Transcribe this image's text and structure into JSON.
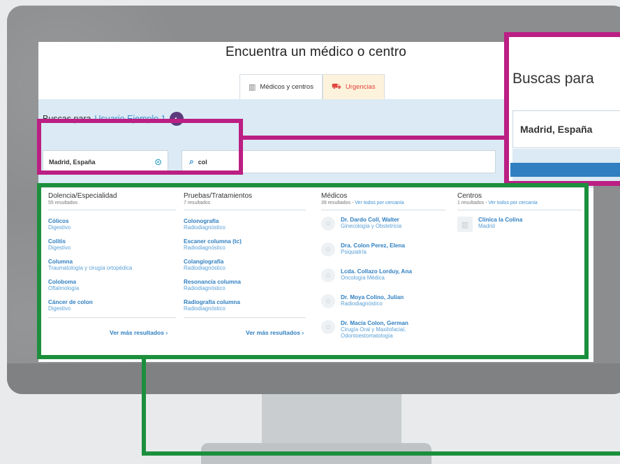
{
  "screen": {
    "title": "Encuentra un médico o centro",
    "tabs": [
      {
        "label": "Médicos y centros",
        "icon": "building-icon"
      },
      {
        "label": "Urgencias",
        "icon": "ambulance-icon"
      }
    ],
    "buscas_para_label": "Buscas para",
    "user_name": "Usuario Ejemplo 1",
    "location_value": "Madrid, España",
    "query_value": "col"
  },
  "callout": {
    "title": "Buscas para",
    "location_value": "Madrid, España"
  },
  "dropdown": {
    "specialties": {
      "header": "Dolencia/Especialidad",
      "count": "55 resultados",
      "items": [
        {
          "title": "Cólicos",
          "subtitle": "Digestivo"
        },
        {
          "title": "Colitis",
          "subtitle": "Digestivo"
        },
        {
          "title": "Columna",
          "subtitle": "Traumatología y cirugía ortopédica"
        },
        {
          "title": "Coloboma",
          "subtitle": "Oftalmología"
        },
        {
          "title": "Cáncer de colon",
          "subtitle": "Digestivo"
        }
      ],
      "more": "Ver más resultados"
    },
    "tests": {
      "header": "Pruebas/Tratamientos",
      "count": "7 resultados",
      "items": [
        {
          "title": "Colonografía",
          "subtitle": "Radiodiagnóstico"
        },
        {
          "title": "Escaner columna (tc)",
          "subtitle": "Radiodiagnóstico"
        },
        {
          "title": "Colangiografía",
          "subtitle": "Radiodiagnóstico"
        },
        {
          "title": "Resonancia columna",
          "subtitle": "Radiodiagnóstico"
        },
        {
          "title": "Radiografía columna",
          "subtitle": "Radiodiagnóstico"
        }
      ],
      "more": "Ver más resultados"
    },
    "doctors": {
      "header": "Médicos",
      "count": "39 resultados",
      "count_link": "Ver todos por cercanía",
      "items": [
        {
          "name": "Dr. Dardo Coll, Walter",
          "specialty": "Ginecología y Obstetricia"
        },
        {
          "name": "Dra. Colon Perez, Elena",
          "specialty": "Psiquiatría"
        },
        {
          "name": "Lcda. Collazo Lorduy, Ana",
          "specialty": "Oncología Médica"
        },
        {
          "name": "Dr. Moya Colino, Julian",
          "specialty": "Radiodiagnóstico"
        },
        {
          "name": "Dr. Macía Colon, German",
          "specialty": "Cirugía Oral y Maxilofacial, Odontoestomatología"
        }
      ]
    },
    "centers": {
      "header": "Centros",
      "count": "1 resultados",
      "count_link": "Ver todos por cercanía",
      "items": [
        {
          "name": "Clínica la Colina",
          "city": "Madrid"
        }
      ]
    }
  },
  "colors": {
    "magenta": "#bb1f83",
    "green": "#1c8f3d",
    "link_blue": "#2f7fc1",
    "band_blue": "#dbeaf4"
  }
}
